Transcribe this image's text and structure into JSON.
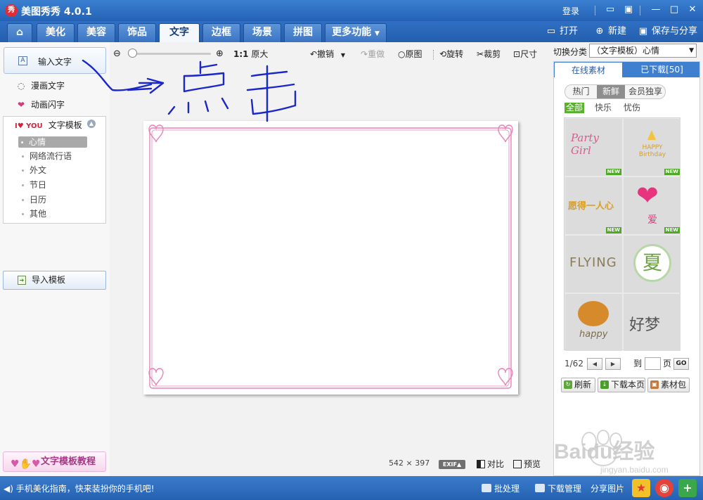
{
  "window": {
    "logo_text": "秀",
    "title": "美图秀秀 4.0.1",
    "login": "登录",
    "icons": [
      "chat-icon",
      "skin-icon",
      "minimize-icon",
      "maximize-icon",
      "close-icon"
    ]
  },
  "nav": {
    "tabs": [
      {
        "label": "",
        "icon": "home-icon"
      },
      {
        "label": "美化"
      },
      {
        "label": "美容"
      },
      {
        "label": "饰品"
      },
      {
        "label": "文字",
        "active": true
      },
      {
        "label": "边框"
      },
      {
        "label": "场景"
      },
      {
        "label": "拼图"
      },
      {
        "label": "更多功能",
        "has_dropdown": true
      }
    ],
    "open": "打开",
    "new": "新建",
    "save_share": "保存与分享"
  },
  "left_panel": {
    "input_text": "输入文字",
    "comic_text": "漫画文字",
    "animated_text": "动画闪字",
    "template_header": "文字模板",
    "template_logo": "I♥ YOU",
    "template_items": [
      "心情",
      "网络流行语",
      "外文",
      "节日",
      "日历",
      "其他"
    ],
    "selected_template": "心情",
    "import_template": "导入模板",
    "tutorial": "文字模板教程"
  },
  "toolbar": {
    "zoom_ratio": "1:1",
    "original_size": "原大",
    "undo": "撤销",
    "redo": "重做",
    "original_image": "原图",
    "rotate": "旋转",
    "crop": "裁剪",
    "size": "尺寸"
  },
  "canvas": {
    "width_px": "542",
    "times": "×",
    "height_px": "397",
    "exif": "EXIF▲",
    "compare": "对比",
    "preview": "预览",
    "frame_color": "#e884b8"
  },
  "right_panel": {
    "switch_label": "切换分类",
    "switch_value": "（文字模板）心情",
    "tab_online": "在线素材",
    "tab_downloaded": "已下载[50]",
    "segments": [
      "热门",
      "新鲜",
      "会员独享"
    ],
    "active_segment": "新鲜",
    "filters": [
      "全部",
      "快乐",
      "忧伤"
    ],
    "active_filter": "全部",
    "tiles": [
      {
        "text": "Party Girl",
        "new": "NEW"
      },
      {
        "text": "HAPPY Birthday",
        "new": "NEW"
      },
      {
        "text": "愿得一人心",
        "new": "NEW"
      },
      {
        "text": "爱",
        "new": "NEW"
      },
      {
        "text": "FLYING"
      },
      {
        "text": "夏"
      },
      {
        "text": "happy"
      },
      {
        "text": "好梦"
      }
    ],
    "page_current": "1/62",
    "page_to": "到",
    "page_unit": "页",
    "page_go": "GO",
    "refresh": "刷新",
    "download_page": "下载本页",
    "material_pack": "素材包"
  },
  "statusbar": {
    "guide": "手机美化指南，快来装扮你的手机吧!",
    "batch": "批处理",
    "download_mgr": "下载管理",
    "share_image": "分享图片"
  },
  "annotation": {
    "text": "点击",
    "color": "#1a27c9"
  },
  "watermark": {
    "brand": "Baidu经验",
    "url": "jingyan.baidu.com"
  }
}
